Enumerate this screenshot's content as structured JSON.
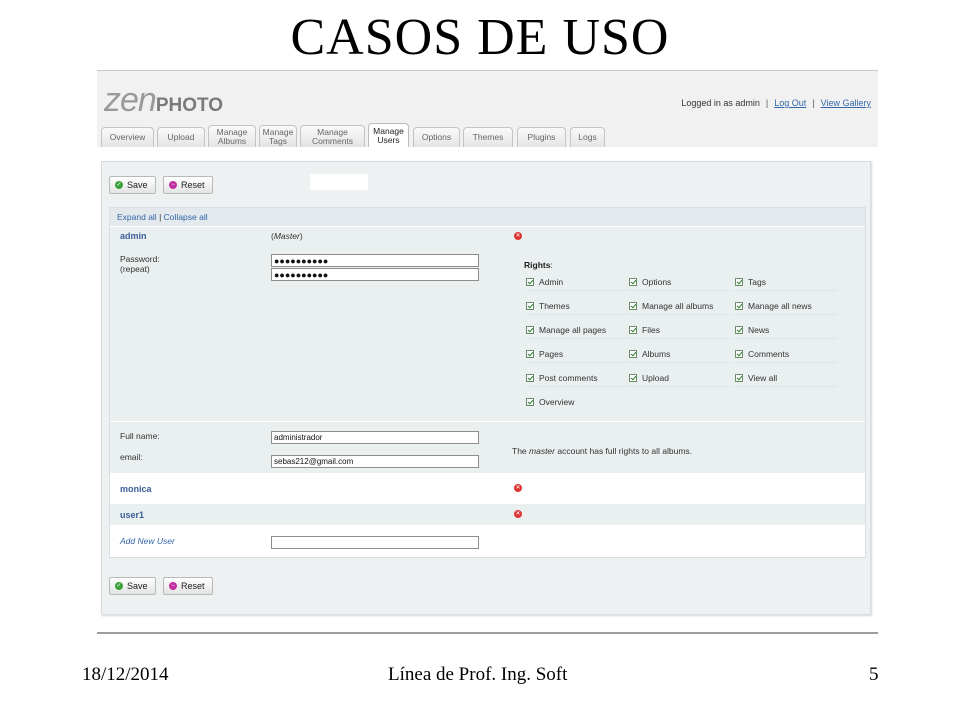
{
  "slide": {
    "title": "CASOS DE USO",
    "footer_date": "18/12/2014",
    "footer_center": "Línea de Prof. Ing. Soft",
    "page_number": "5"
  },
  "app": {
    "logo_zen": "ZEN",
    "logo_photo": "PHOTO",
    "logged_in_text": "Logged in as admin",
    "logout_label": "Log Out",
    "view_gallery_label": "View Gallery",
    "separator": "|"
  },
  "tabs": [
    {
      "label": "Overview"
    },
    {
      "label": "Upload"
    },
    {
      "label": "Manage Albums"
    },
    {
      "label": "Manage Tags"
    },
    {
      "label": "Manage Comments"
    },
    {
      "label": "Manage Users",
      "active": true
    },
    {
      "label": "Options"
    },
    {
      "label": "Themes"
    },
    {
      "label": "Plugins"
    },
    {
      "label": "Logs"
    }
  ],
  "toolbar": {
    "save_label": "Save",
    "reset_label": "Reset"
  },
  "users_panel": {
    "expand_all": "Expand all",
    "divider": "|",
    "collapse_all": "Collapse all"
  },
  "admin_user": {
    "username": "admin",
    "role": "Master",
    "password_label": "Password:",
    "repeat_label": "(repeat)",
    "password_value": "●●●●●●●●●●",
    "password_repeat_value": "●●●●●●●●●●",
    "rights_label": "Rights",
    "rights": [
      {
        "label": "Admin",
        "checked": true
      },
      {
        "label": "Options",
        "checked": true
      },
      {
        "label": "Tags",
        "checked": true
      },
      {
        "label": "Themes",
        "checked": true
      },
      {
        "label": "Manage all albums",
        "checked": true
      },
      {
        "label": "Manage all news",
        "checked": true
      },
      {
        "label": "Manage all pages",
        "checked": true
      },
      {
        "label": "Files",
        "checked": true
      },
      {
        "label": "News",
        "checked": true
      },
      {
        "label": "Pages",
        "checked": true
      },
      {
        "label": "Albums",
        "checked": true
      },
      {
        "label": "Comments",
        "checked": true
      },
      {
        "label": "Post comments",
        "checked": true
      },
      {
        "label": "Upload",
        "checked": true
      },
      {
        "label": "View all",
        "checked": true
      },
      {
        "label": "Overview",
        "checked": true
      }
    ],
    "fullname_label": "Full name:",
    "fullname_value": "administrador",
    "email_label": "email:",
    "email_value": "sebas212@gmail.com",
    "note_prefix": "The ",
    "note_emphasis": "master",
    "note_suffix": " account has full rights to all albums."
  },
  "other_users": [
    {
      "username": "monica"
    },
    {
      "username": "user1"
    }
  ],
  "add_user": {
    "label": "Add New User",
    "value": ""
  },
  "colors": {
    "accent_link": "#3366aa",
    "panel_bg": "#eef1f2",
    "save_icon": "#3aa33a",
    "reset_icon": "#c030a0",
    "delete_icon": "#dd3333"
  },
  "icons": {
    "save": "check-circle-icon",
    "reset": "minus-circle-icon",
    "delete": "x-circle-icon",
    "checkbox": "checkbox-checked-icon"
  }
}
